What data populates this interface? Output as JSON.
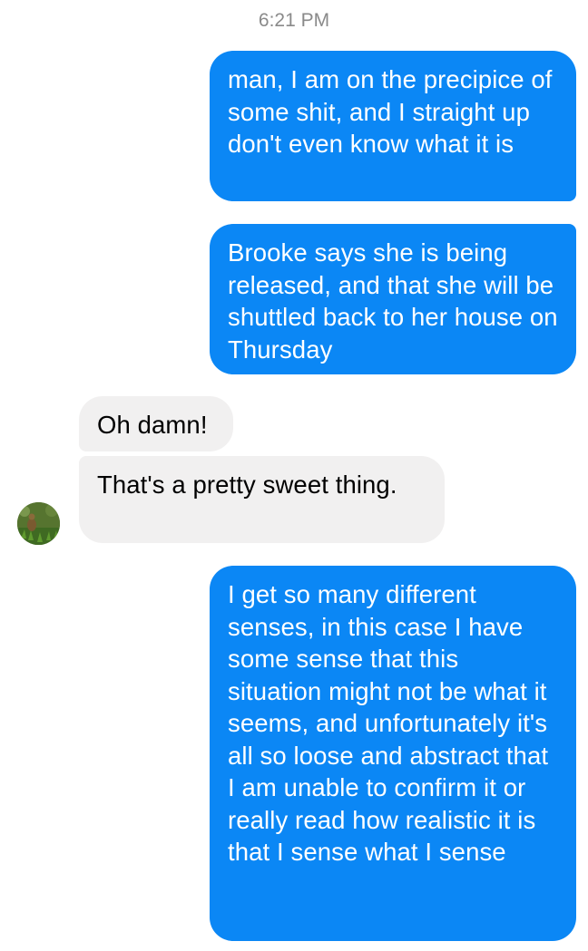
{
  "conversation": {
    "timestamp": "6:21 PM",
    "messages": [
      {
        "sender": "me",
        "text": "man, I am on the precipice of some shit, and I straight up don't even know what it is"
      },
      {
        "sender": "me",
        "text": "Brooke says she is being released, and that she will be shuttled back to her house on Thursday"
      },
      {
        "sender": "contact",
        "text": "Oh damn!"
      },
      {
        "sender": "contact",
        "text": "That's a pretty sweet thing."
      },
      {
        "sender": "me",
        "text": "I get so many different senses, in this case I have some sense that this situation might not be what it seems, and unfortunately it's all so loose and abstract that I am unable to confirm it or really read how realistic it is that I sense what I sense"
      }
    ]
  },
  "colors": {
    "outgoing_bubble": "#0b87f5",
    "incoming_bubble": "#f1f0f0",
    "timestamp_text": "#8a8a8a"
  },
  "contact": {
    "avatar_icon": "contact-avatar-photo"
  }
}
